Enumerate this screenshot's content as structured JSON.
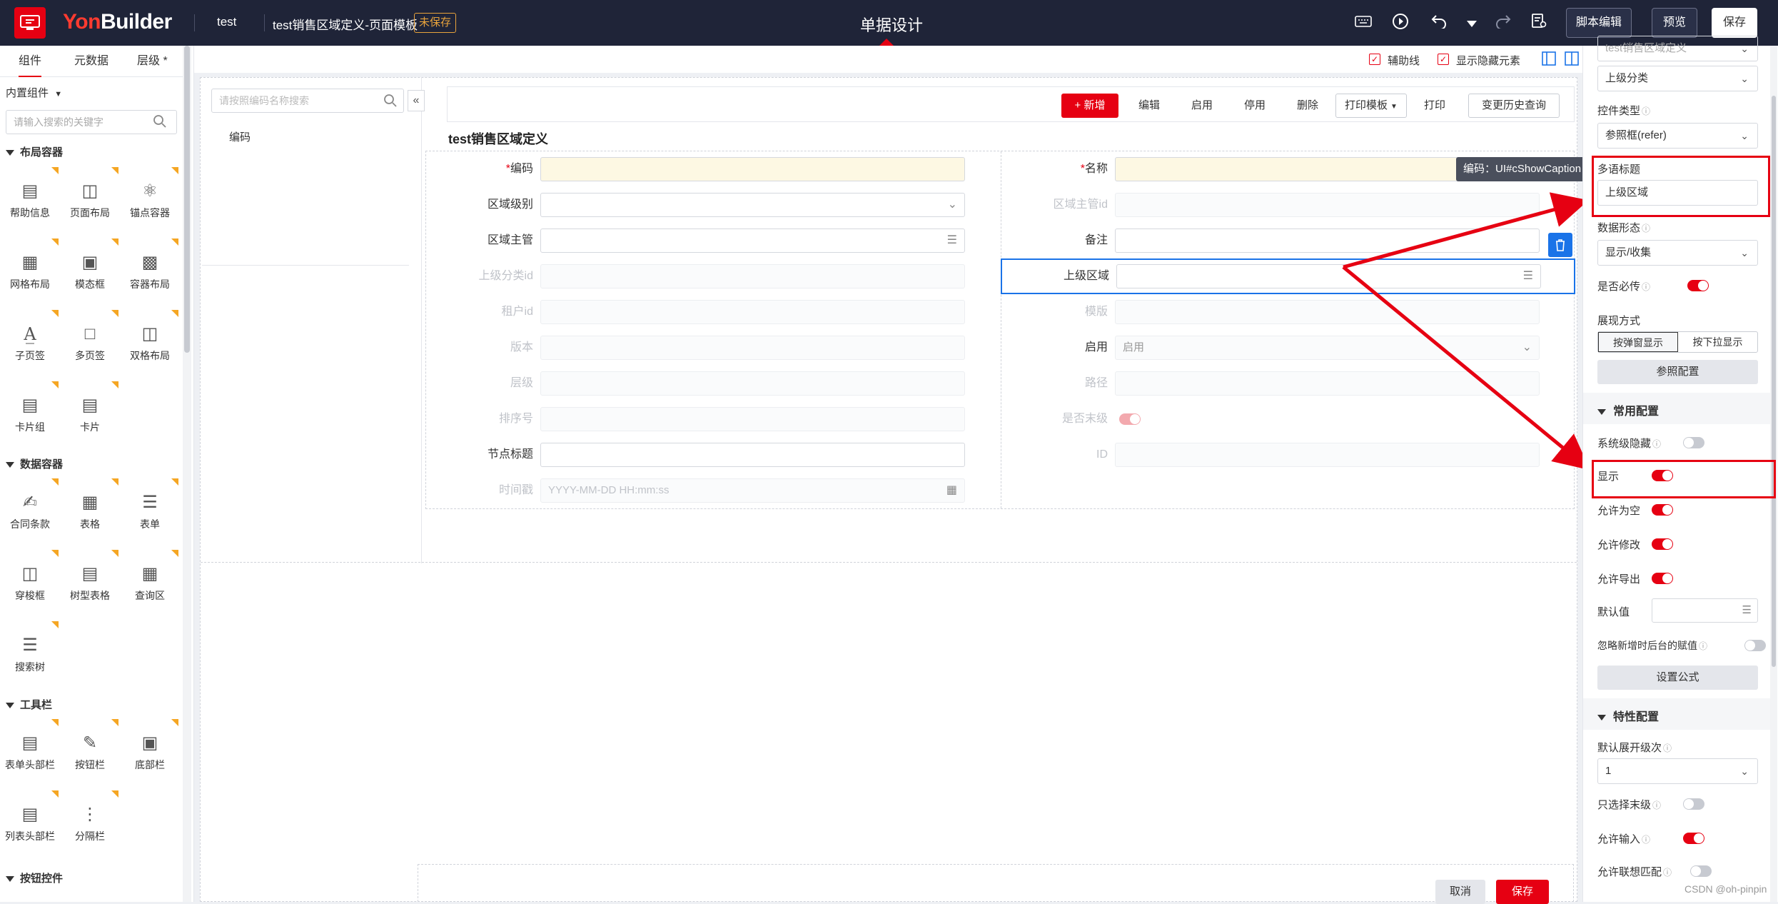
{
  "header": {
    "brand": "YonBuilder",
    "app": "test",
    "doc_title": "test销售区域定义-页面模板",
    "unsaved_badge": "未保存",
    "center_title": "单据设计",
    "script_edit": "脚本编辑",
    "preview": "预览",
    "save": "保存"
  },
  "left": {
    "tabs": [
      "组件",
      "元数据",
      "层级 *"
    ],
    "builtin": "内置组件",
    "search_placeholder": "请输入搜索的关键字",
    "categories": {
      "layout": "布局容器",
      "data": "数据容器",
      "toolbar": "工具栏",
      "button": "按钮控件"
    },
    "layout_items": [
      "帮助信息",
      "页面布局",
      "锚点容器",
      "网格布局",
      "模态框",
      "容器布局",
      "子页签",
      "多页签",
      "双格布局",
      "卡片组",
      "卡片"
    ],
    "data_items": [
      "合同条款",
      "表格",
      "表单",
      "穿梭框",
      "树型表格",
      "查询区",
      "搜索树"
    ],
    "toolbar_items": [
      "表单头部栏",
      "按钮栏",
      "底部栏",
      "列表头部栏",
      "分隔栏"
    ]
  },
  "canvas_options": {
    "guide": "辅助线",
    "show_hidden": "显示隐藏元素"
  },
  "tree": {
    "search_placeholder": "请按照编码名称搜索",
    "node": "编码"
  },
  "toolbar": {
    "add": "新增",
    "edit": "编辑",
    "enable": "启用",
    "disable": "停用",
    "delete": "删除",
    "print_template": "打印模板",
    "print": "打印",
    "history": "变更历史查询"
  },
  "form": {
    "title": "test销售区域定义",
    "left": [
      {
        "label": "编码",
        "required": true,
        "value": ""
      },
      {
        "label": "区域级别",
        "value": ""
      },
      {
        "label": "区域主管",
        "value": ""
      },
      {
        "label": "上级分类id",
        "value": ""
      },
      {
        "label": "租户id",
        "value": ""
      },
      {
        "label": "版本",
        "value": ""
      },
      {
        "label": "层级",
        "value": ""
      },
      {
        "label": "排序号",
        "value": ""
      },
      {
        "label": "节点标题",
        "value": ""
      },
      {
        "label": "时间戳",
        "placeholder": "YYYY-MM-DD HH:mm:ss"
      }
    ],
    "right": [
      {
        "label": "名称",
        "required": true,
        "value": ""
      },
      {
        "label": "区域主管id",
        "value": ""
      },
      {
        "label": "备注",
        "value": ""
      },
      {
        "label": "上级区域",
        "value": ""
      },
      {
        "label": "模版",
        "value": ""
      },
      {
        "label": "启用",
        "value": "启用"
      },
      {
        "label": "路径",
        "value": ""
      },
      {
        "label": "是否末级",
        "value": ""
      },
      {
        "label": "ID",
        "value": ""
      }
    ]
  },
  "tooltip": "编码：UI#cShowCaption",
  "right": {
    "top_value": "test销售区域定义",
    "parent_select": "上级分类",
    "control_type_label": "控件类型",
    "control_type": "参照框(refer)",
    "caption_label": "多语标题",
    "caption_value": "上级区域",
    "data_form_label": "数据形态",
    "data_form": "显示/收集",
    "must_pass": "是否必传",
    "display_mode": "展现方式",
    "popup_display": "按弹窗显示",
    "dropdown_display": "按下拉显示",
    "ref_config": "参照配置",
    "common_config": "常用配置",
    "system_hidden": "系统级隐藏",
    "show": "显示",
    "allow_empty": "允许为空",
    "allow_edit": "允许修改",
    "allow_export": "允许导出",
    "default_value": "默认值",
    "ignore_backend": "忽略新增时后台的赋值",
    "set_formula": "设置公式",
    "feature_config": "特性配置",
    "default_expand_label": "默认展开级次",
    "default_expand": "1",
    "only_leaf": "只选择末级",
    "allow_input": "允许输入",
    "allow_assoc": "允许联想匹配"
  },
  "footer": {
    "cancel": "取消",
    "save": "保存"
  },
  "watermark": "CSDN @oh-pinpin",
  "colors": {
    "accent": "#e60012",
    "header_bg": "#1f2438",
    "warning": "#e8a33c"
  }
}
